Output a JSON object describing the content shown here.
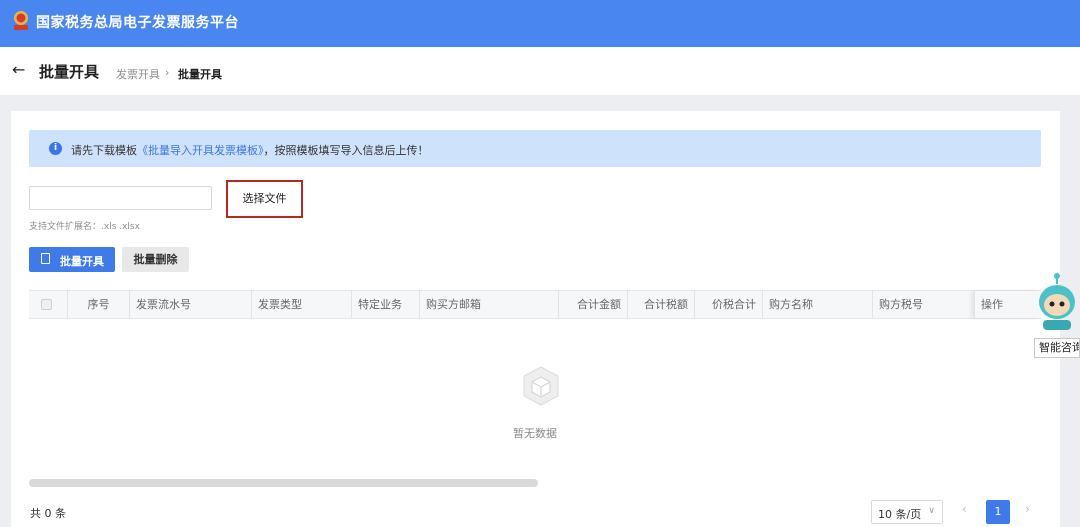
{
  "header": {
    "app_title": "国家税务总局电子发票服务平台"
  },
  "page": {
    "title": "批量开具",
    "breadcrumb": [
      "发票开具",
      "批量开具"
    ],
    "breadcrumb_sep": "›"
  },
  "notice": {
    "prefix": "请先下载模板",
    "link": "《批量导入开具发票模板》",
    "suffix": "，按照模板填写导入信息后上传！"
  },
  "upload": {
    "file_value": "",
    "choose_label": "选择文件",
    "hint": "支持文件扩展名：.xls .xlsx"
  },
  "actions": {
    "batch_issue": "批量开具",
    "batch_delete": "批量删除"
  },
  "table": {
    "columns": [
      "序号",
      "发票流水号",
      "发票类型",
      "特定业务",
      "购买方邮箱",
      "合计金额",
      "合计税额",
      "价税合计",
      "购方名称",
      "购方税号",
      "操作"
    ],
    "empty_text": "暂无数据"
  },
  "footer": {
    "total": "共 0 条",
    "page_size": "10 条/页",
    "current_page": "1"
  },
  "assistant": {
    "label": "智能咨询"
  },
  "icons": {
    "back": "arrow-left-icon",
    "info": "info-icon",
    "doc": "document-icon",
    "empty": "empty-box-icon"
  },
  "colors": {
    "header": "#4a86f0",
    "primary": "#3f7be8",
    "highlight": "#b22a22",
    "notice_bg": "#cfe2fb"
  }
}
